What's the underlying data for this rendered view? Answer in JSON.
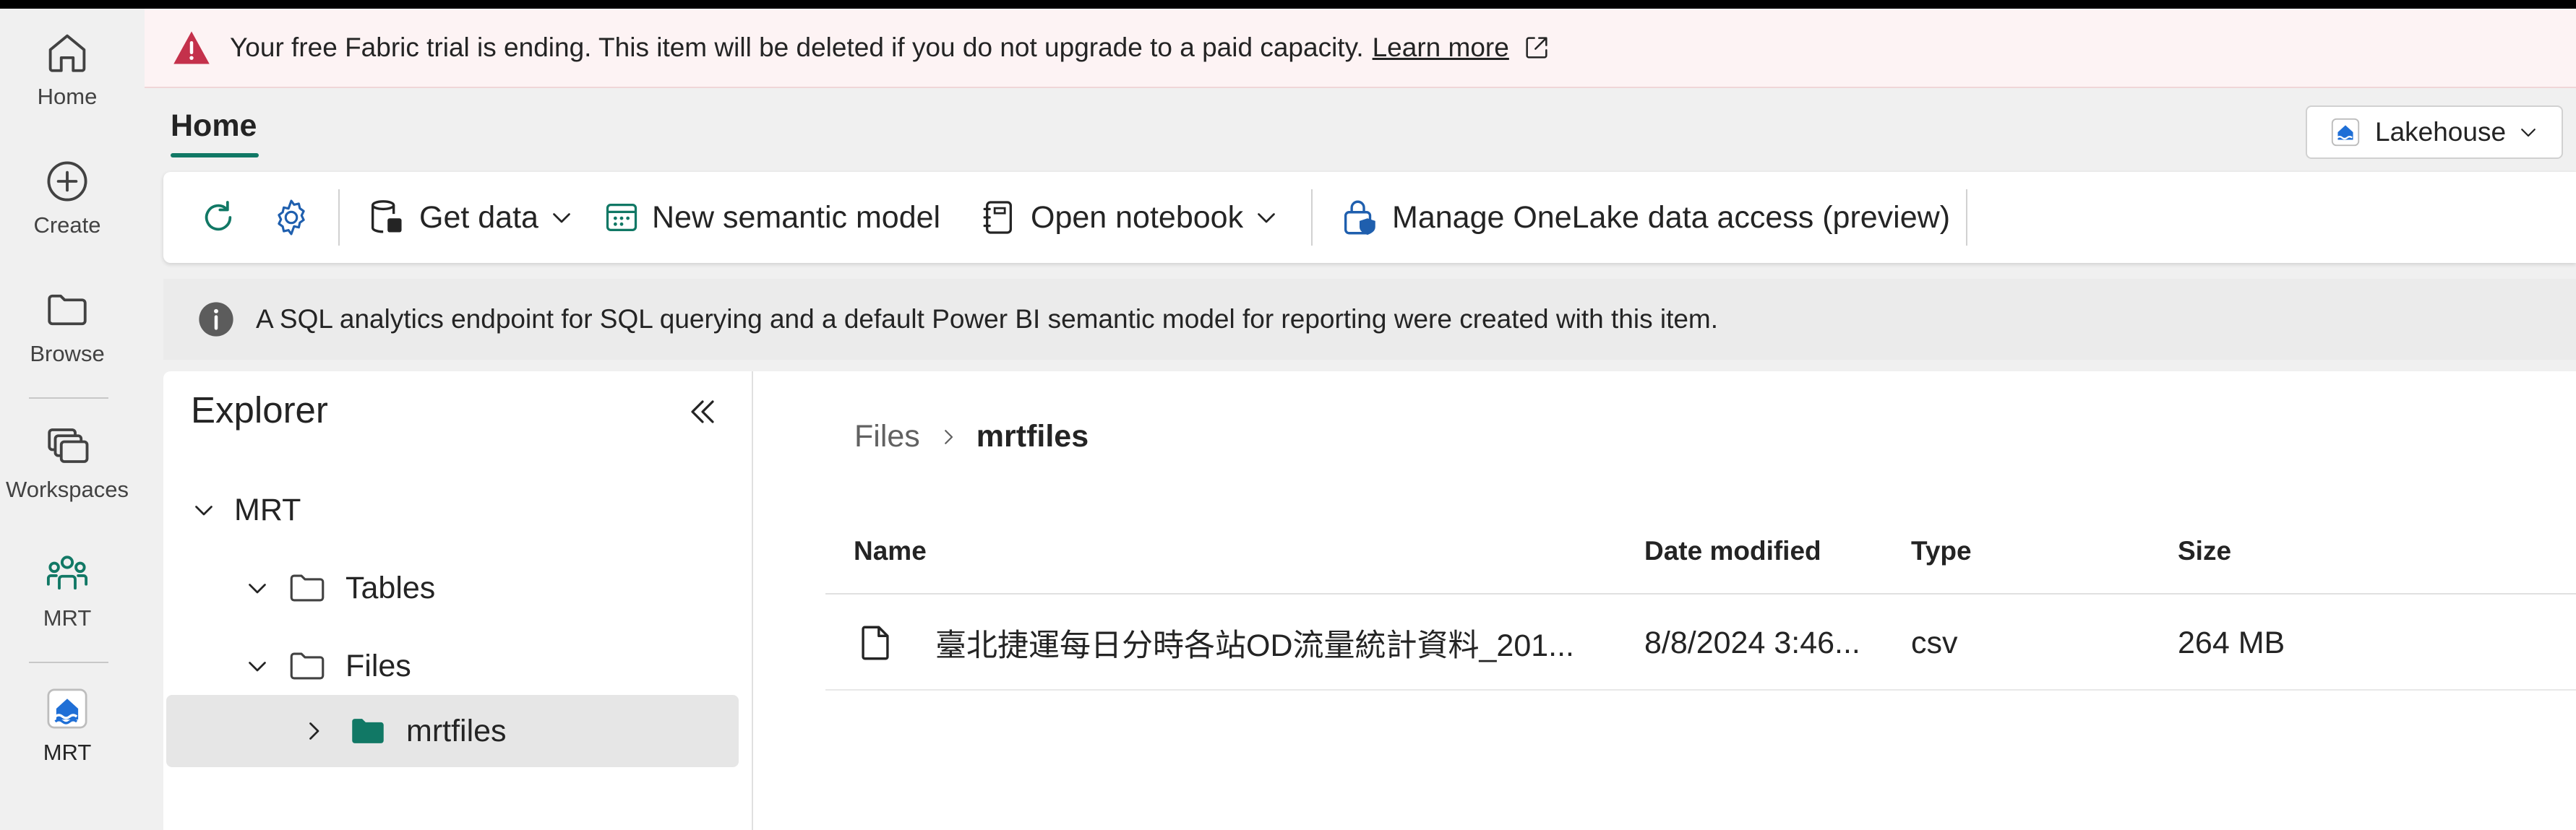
{
  "rail": {
    "items": [
      {
        "label": "Home"
      },
      {
        "label": "Create"
      },
      {
        "label": "Browse"
      },
      {
        "label": "Workspaces"
      },
      {
        "label": "MRT"
      },
      {
        "label": "MRT"
      }
    ]
  },
  "banner": {
    "message": "Your free Fabric trial is ending. This item will be deleted if you do not upgrade to a paid capacity.",
    "link": "Learn more"
  },
  "header": {
    "tab": "Home",
    "item_type": "Lakehouse"
  },
  "toolbar": {
    "get_data": "Get data",
    "new_semantic_model": "New semantic model",
    "open_notebook": "Open notebook",
    "manage_access": "Manage OneLake data access (preview)"
  },
  "info": {
    "message": "A SQL analytics endpoint for SQL querying and a default Power BI semantic model for reporting were created with this item."
  },
  "explorer": {
    "title": "Explorer",
    "root": "MRT",
    "tables": "Tables",
    "files": "Files",
    "subfolder": "mrtfiles"
  },
  "main": {
    "breadcrumb": [
      "Files",
      "mrtfiles"
    ],
    "columns": {
      "name": "Name",
      "date": "Date modified",
      "type": "Type",
      "size": "Size"
    },
    "rows": [
      {
        "name": "臺北捷運每日分時各站OD流量統計資料_201...",
        "date": "8/8/2024 3:46...",
        "type": "csv",
        "size": "264 MB"
      }
    ]
  },
  "colors": {
    "accent": "#117865",
    "warning": "#c4314b",
    "folder_green": "#117865"
  }
}
